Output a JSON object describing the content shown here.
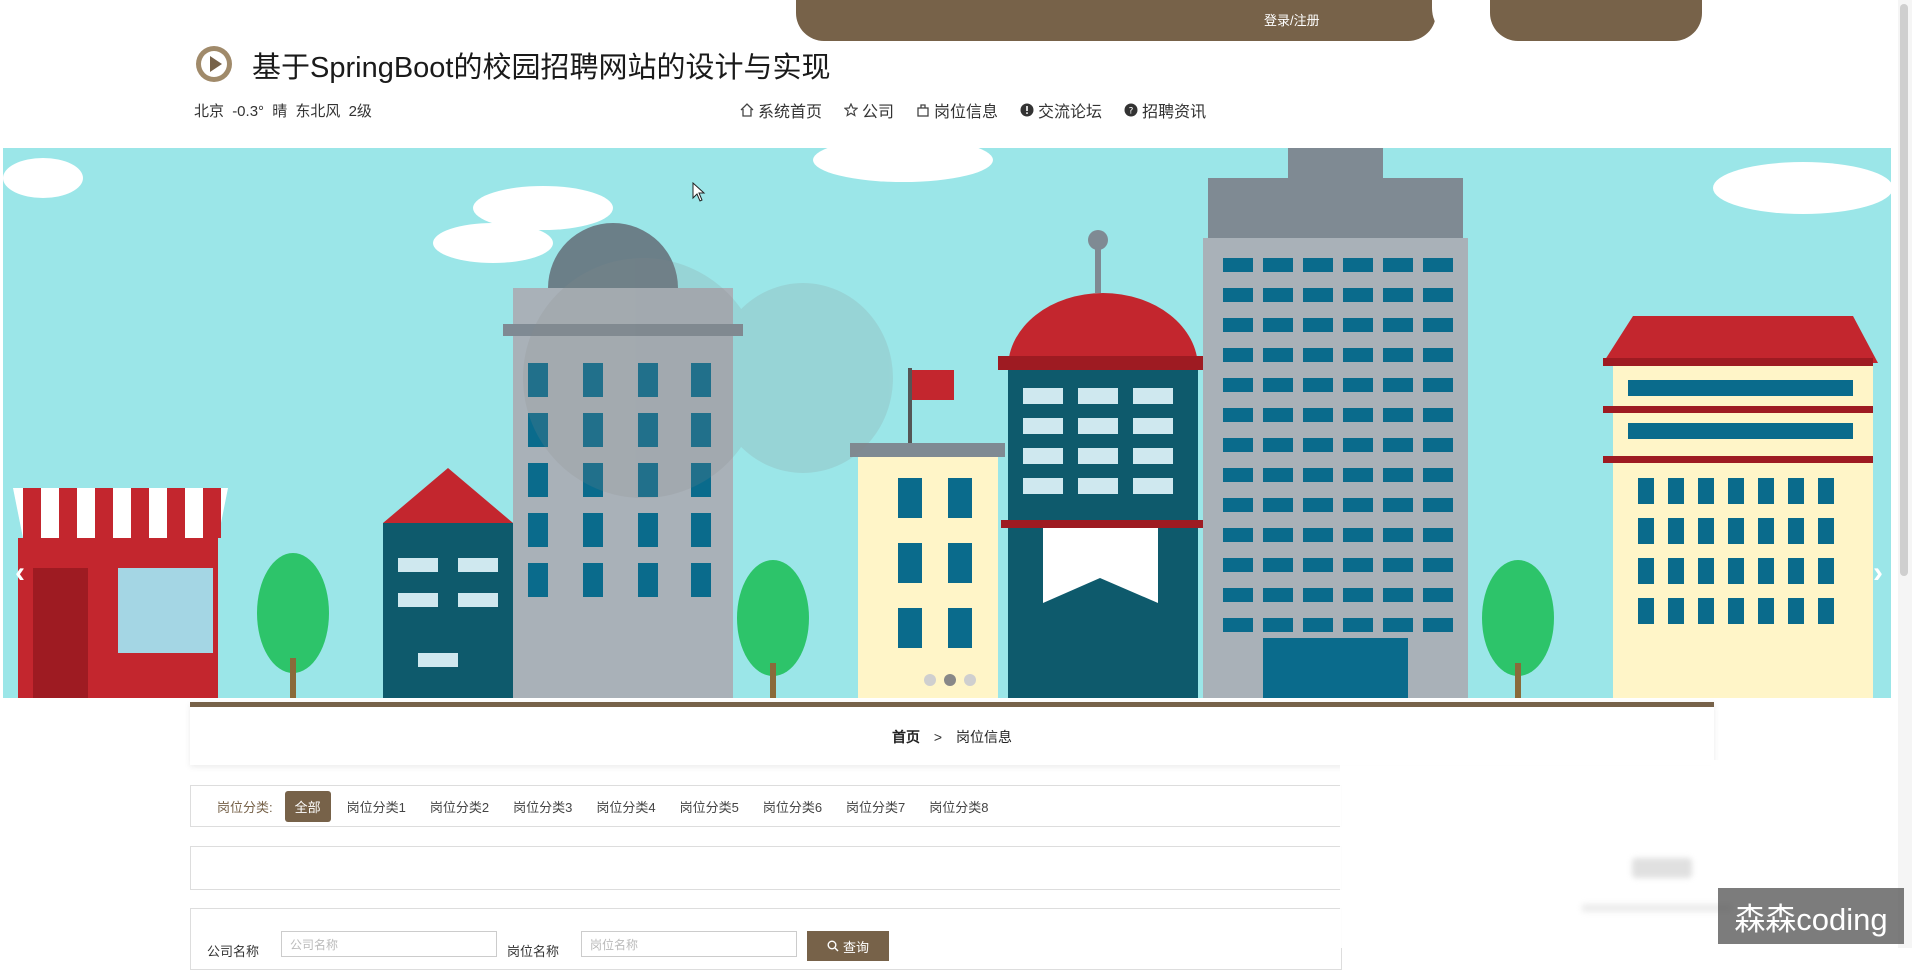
{
  "auth": {
    "login_label": "登录/注册"
  },
  "header": {
    "title": "基于SpringBoot的校园招聘网站的设计与实现",
    "weather": {
      "city": "北京",
      "temp": "-0.3°",
      "condition": "晴",
      "wind": "东北风",
      "level": "2级"
    }
  },
  "nav": [
    {
      "label": "系统首页",
      "icon": "home-icon"
    },
    {
      "label": "公司",
      "icon": "star-icon"
    },
    {
      "label": "岗位信息",
      "icon": "bag-icon"
    },
    {
      "label": "交流论坛",
      "icon": "alert-icon"
    },
    {
      "label": "招聘资讯",
      "icon": "question-icon"
    }
  ],
  "banner": {
    "prev": "‹",
    "next": "›",
    "slides": 3,
    "active_slide": 2
  },
  "breadcrumb": {
    "home": "首页",
    "separator": ">",
    "current": "岗位信息"
  },
  "filter": {
    "label": "岗位分类:",
    "items": [
      "全部",
      "岗位分类1",
      "岗位分类2",
      "岗位分类3",
      "岗位分类4",
      "岗位分类5",
      "岗位分类6",
      "岗位分类7",
      "岗位分类8"
    ]
  },
  "search": {
    "company_label": "公司名称",
    "company_placeholder": "公司名称",
    "job_label": "岗位名称",
    "job_placeholder": "岗位名称",
    "button_label": "查询"
  },
  "watermark": "森森coding",
  "colors": {
    "accent": "#776249",
    "sky": "#9be6e8"
  }
}
